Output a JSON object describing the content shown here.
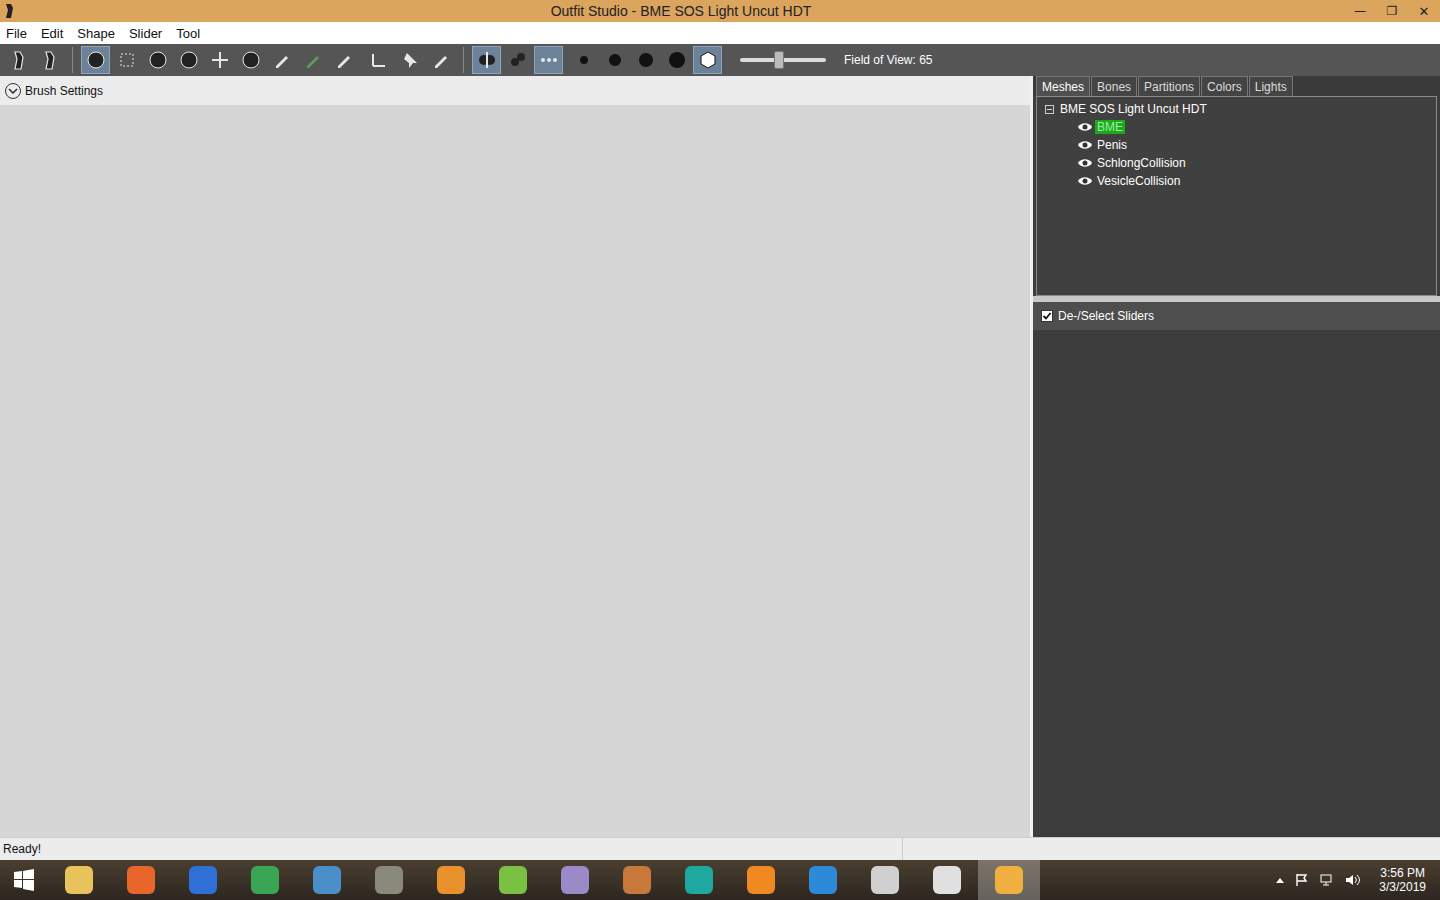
{
  "window": {
    "title": "Outfit Studio - BME SOS Light Uncut HDT",
    "controls": [
      "—",
      "❐",
      "✕"
    ]
  },
  "menu": [
    "File",
    "Edit",
    "Shape",
    "Slider",
    "Tool"
  ],
  "toolbar": {
    "groups": [
      {
        "buttons": [
          {
            "kind": "outfit",
            "selected": false
          },
          {
            "kind": "outfit-alt",
            "selected": false
          }
        ]
      },
      {
        "buttons": [
          {
            "kind": "brush",
            "selected": true
          },
          {
            "kind": "select",
            "selected": false
          },
          {
            "kind": "inflate",
            "selected": false
          },
          {
            "kind": "deflate",
            "selected": false
          },
          {
            "kind": "move",
            "selected": false
          },
          {
            "kind": "smooth",
            "selected": false
          },
          {
            "kind": "pencil",
            "selected": false
          },
          {
            "kind": "color",
            "selected": false
          },
          {
            "kind": "paint",
            "selected": false
          }
        ]
      },
      {
        "buttons": [
          {
            "kind": "transform",
            "selected": false
          },
          {
            "kind": "pin",
            "selected": false
          },
          {
            "kind": "eraser",
            "selected": false
          }
        ]
      },
      {
        "buttons": [
          {
            "kind": "mirror",
            "selected": true
          },
          {
            "kind": "connected",
            "selected": false
          },
          {
            "kind": "dots",
            "selected": true
          }
        ]
      },
      {
        "buttons": [
          {
            "kind": "dot-sm",
            "selected": false
          },
          {
            "kind": "dot-md",
            "selected": false
          },
          {
            "kind": "dot-lg",
            "selected": false
          },
          {
            "kind": "dot-xl",
            "selected": false
          },
          {
            "kind": "cube",
            "selected": true
          }
        ]
      }
    ],
    "fov": {
      "label": "Field of View: 65",
      "level": 0.45
    }
  },
  "brush_settings": {
    "label": "Brush Settings",
    "expanded": false
  },
  "panel": {
    "tabs": [
      {
        "label": "Meshes",
        "selected": true
      },
      {
        "label": "Bones",
        "selected": false
      },
      {
        "label": "Partitions",
        "selected": false
      },
      {
        "label": "Colors",
        "selected": false
      },
      {
        "label": "Lights",
        "selected": false
      }
    ],
    "tree": {
      "root": "BME SOS Light Uncut HDT",
      "expanded": true,
      "items": [
        {
          "label": "BME",
          "selected": true
        },
        {
          "label": "Penis",
          "selected": false
        },
        {
          "label": "SchlongCollision",
          "selected": false
        },
        {
          "label": "VesicleCollision",
          "selected": false
        }
      ]
    },
    "sliders": {
      "label": "De-/Select Sliders",
      "checked": true
    }
  },
  "status_bar": {
    "text": "Ready!"
  },
  "taskbar": {
    "apps": [
      {
        "color": "#e8c25a",
        "selected": false
      },
      {
        "color": "#e8662a",
        "selected": false
      },
      {
        "color": "#2f6fd6",
        "selected": false
      },
      {
        "color": "#3aa655",
        "selected": false
      },
      {
        "color": "#4a8fc9",
        "selected": false
      },
      {
        "color": "#8a8a7a",
        "selected": false
      },
      {
        "color": "#e8902a",
        "selected": false
      },
      {
        "color": "#7ac043",
        "selected": false
      },
      {
        "color": "#9a8ac8",
        "selected": false
      },
      {
        "color": "#c8783a",
        "selected": false
      },
      {
        "color": "#1fa8a0",
        "selected": false
      },
      {
        "color": "#f08a20",
        "selected": false
      },
      {
        "color": "#2c8ad8",
        "selected": false
      },
      {
        "color": "#d0d0d0",
        "selected": false
      },
      {
        "color": "#e0e0e0",
        "selected": false
      },
      {
        "color": "#f0b040",
        "selected": true
      }
    ],
    "time": "3:56 PM",
    "date": "3/3/2019"
  }
}
